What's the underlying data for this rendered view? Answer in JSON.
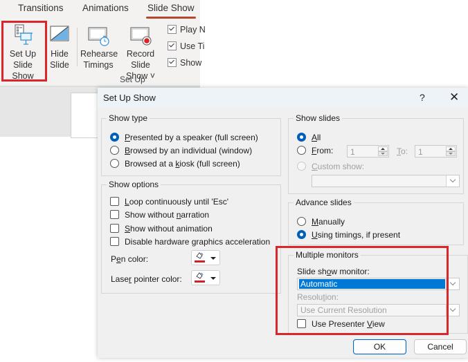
{
  "ribbon": {
    "tabs": [
      {
        "label": "Transitions",
        "active": false
      },
      {
        "label": "Animations",
        "active": false
      },
      {
        "label": "Slide Show",
        "active": true
      }
    ],
    "buttons": {
      "setup_line1": "Set Up",
      "setup_line2": "Slide Show",
      "hide_line1": "Hide",
      "hide_line2": "Slide",
      "rehearse_line1": "Rehearse",
      "rehearse_line2": "Timings",
      "record_line1": "Record Slide",
      "record_line2": "Show ˅"
    },
    "group_label": "Set Up",
    "checks": [
      {
        "label": "Play N",
        "checked": true
      },
      {
        "label": "Use Ti",
        "checked": true
      },
      {
        "label": "Show",
        "checked": true
      }
    ],
    "highlight_color": "#d9262b"
  },
  "dialog": {
    "title": "Set Up Show",
    "help": "?",
    "close": "✕",
    "show_type": {
      "label": "Show type",
      "options": [
        {
          "pre": "",
          "key": "P",
          "post": "resented by a speaker (full screen)",
          "selected": true
        },
        {
          "pre": "",
          "key": "B",
          "post": "rowsed by an individual (window)",
          "selected": false
        },
        {
          "pre": "Browsed at a ",
          "key": "k",
          "post": "iosk (full screen)",
          "selected": false
        }
      ]
    },
    "show_options": {
      "label": "Show options",
      "checks": [
        {
          "pre": "",
          "key": "L",
          "post": "oop continuously until 'Esc'",
          "checked": false
        },
        {
          "pre": "Show without ",
          "key": "n",
          "post": "arration",
          "checked": false
        },
        {
          "pre": "",
          "key": "S",
          "post": "how without animation",
          "checked": false
        },
        {
          "pre": "Disable hardware ",
          "key": "g",
          "post": "raphics acceleration",
          "checked": false
        }
      ],
      "pen_color": {
        "pre": "P",
        "key": "e",
        "post": "n color:"
      },
      "laser_color": {
        "pre": "Lase",
        "key": "r",
        "post": " pointer color:"
      },
      "pen_swatch": "#d0202a",
      "laser_swatch": "#d0202a"
    },
    "show_slides": {
      "label": "Show slides",
      "all": {
        "key": "A",
        "post": "ll",
        "selected": true
      },
      "from": {
        "key": "F",
        "post": "rom:",
        "selected": false,
        "value": "1"
      },
      "to": {
        "key": "T",
        "post": "o:",
        "value": "1"
      },
      "custom": {
        "key": "C",
        "post": "ustom show:",
        "selected": false,
        "disabled": true,
        "value": ""
      }
    },
    "advance_slides": {
      "label": "Advance slides",
      "options": [
        {
          "key": "M",
          "post": "anually",
          "selected": false
        },
        {
          "key": "U",
          "post": "sing timings, if present",
          "selected": true
        }
      ]
    },
    "multiple_monitors": {
      "label": "Multiple monitors",
      "monitor_label": {
        "pre": "Slide sh",
        "key": "o",
        "post": "w monitor:"
      },
      "monitor_value": "Automatic",
      "resolution_label": {
        "pre": "Resolu",
        "key": "t",
        "post": "ion:"
      },
      "resolution_value": "Use Current Resolution",
      "presenter_view": {
        "pre": "Use Presenter ",
        "key": "V",
        "post": "iew",
        "checked": false
      }
    },
    "ok": "OK",
    "cancel": "Cancel"
  }
}
